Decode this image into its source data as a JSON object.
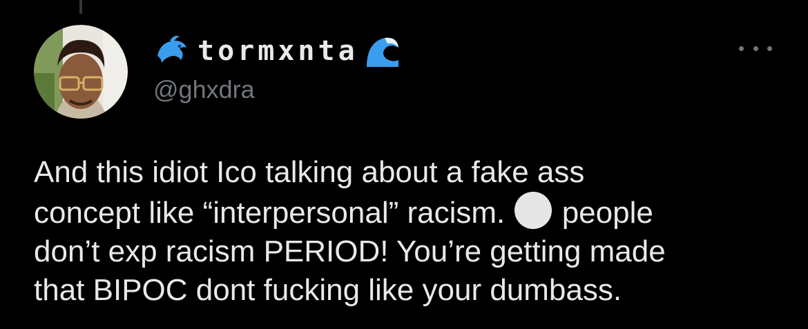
{
  "tweet": {
    "display_name": "tormxnta",
    "handle": "@ghxdra",
    "text_part1": "And this idiot Ico talking about a fake ass\nconcept like “interpersonal” racism. ",
    "text_part2": " people\ndon’t exp racism PERIOD! You’re getting made\nthat BIPOC dont fucking like your dumbass.",
    "name_prefix_icon": "dolphin-emoji",
    "name_suffix_icon": "wave-emoji",
    "inline_icon": "white-circle-emoji"
  },
  "colors": {
    "background": "#000000",
    "text": "#e7e9ea",
    "secondary_text": "#71767b",
    "emoji_blue": "#3b9ded"
  }
}
